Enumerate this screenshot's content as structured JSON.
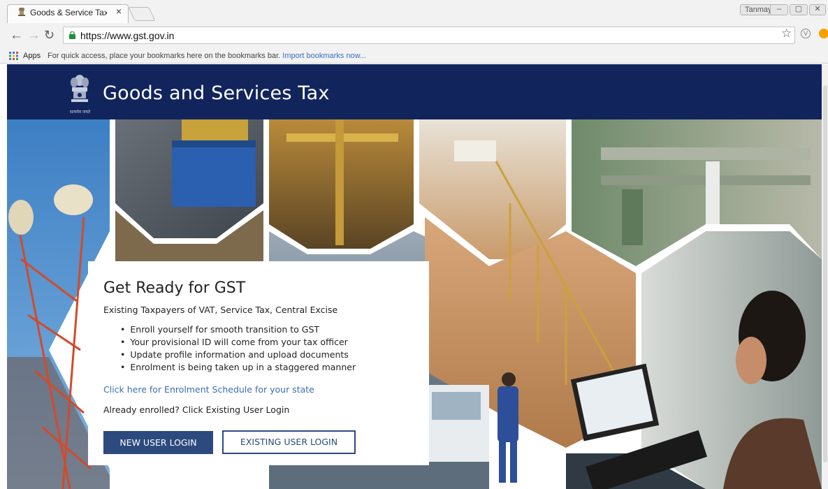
{
  "browser": {
    "tab_title": "Goods & Service Tax (GS",
    "tab_close": "×",
    "window_user": "Tanmay",
    "url": "https://www.gst.gov.in",
    "bookmarks_apps": "Apps",
    "bookmarks_hint": "For quick access, place your bookmarks here on the bookmarks bar.",
    "bookmarks_import": "Import bookmarks now...",
    "icons": {
      "back": "arrow-left-icon",
      "forward": "arrow-right-icon",
      "reload": "reload-icon",
      "lock": "lock-icon",
      "star": "star-icon"
    }
  },
  "header": {
    "title": "Goods and Services Tax",
    "emblem_text": "सत्यमेव जयते"
  },
  "card": {
    "title": "Get Ready for GST",
    "subtitle": "Existing Taxpayers of VAT, Service Tax, Central Excise",
    "bullets": [
      "Enroll yourself for smooth transition to GST",
      "Your provisional ID will come from your tax officer",
      "Update profile information and upload documents",
      "Enrolment is being taken up in a staggered manner"
    ],
    "schedule_link": "Click here for Enrolment Schedule for your state",
    "already_text": "Already enrolled? Click Existing User Login",
    "new_user_button": "NEW USER LOGIN",
    "existing_user_button": "EXISTING USER LOGIN"
  },
  "colors": {
    "header_bg": "#11245c",
    "button_primary": "#2c4a7e",
    "link": "#3b6db5"
  }
}
